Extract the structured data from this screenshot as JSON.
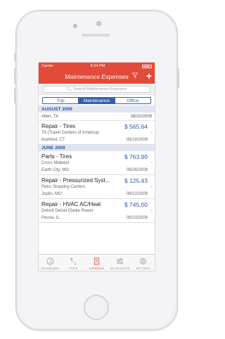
{
  "status": {
    "carrier": "Carrier",
    "time": "9:24 PM"
  },
  "nav": {
    "title": "Maintenance Expenses",
    "filter_icon": "filter-icon",
    "add_icon": "plus-icon"
  },
  "search": {
    "placeholder": "Search Maintenance Expenses"
  },
  "segments": [
    {
      "label": "Trip",
      "active": false
    },
    {
      "label": "Maintenance",
      "active": true
    },
    {
      "label": "Office",
      "active": false
    }
  ],
  "sections": [
    {
      "header": "AUGUST 2009",
      "summary": {
        "location": "Allen, TX",
        "date": "08/20/2009"
      },
      "rows": [
        {
          "title": "Repair - Tires",
          "amount": "$ 565.64",
          "vendor": "TA (Travel Centers of America)",
          "location": "branford, CT",
          "date": "08/18/2009"
        }
      ]
    },
    {
      "header": "JUNE 2009",
      "rows": [
        {
          "title": "Parts - Tires",
          "amount": "$ 763.90",
          "vendor": "Cross Midwest",
          "location": "Earth City, MO",
          "date": "06/26/2009"
        },
        {
          "title": "Repair - Pressurized Syst...",
          "amount": "$ 125.43",
          "vendor": "Petro Stopping Centers",
          "location": "Joplin, MO",
          "date": "06/12/2009"
        },
        {
          "title": "Repair - HVAC AC/Heat",
          "amount": "$ 745.00",
          "vendor": "Detroit Deisel Clarke Power",
          "location": "Peoria, IL",
          "date": "06/10/2009"
        }
      ]
    }
  ],
  "tabs": [
    {
      "label": "DASHBOARD",
      "icon": "dashboard-gauge-icon",
      "active": false
    },
    {
      "label": "TRIPS",
      "icon": "route-pin-icon",
      "active": false
    },
    {
      "label": "EXPENSES",
      "icon": "receipt-icon",
      "active": true
    },
    {
      "label": "MY BUSINESS",
      "icon": "sliders-icon",
      "active": false
    },
    {
      "label": "SETTINGS",
      "icon": "gear-icon",
      "active": false
    }
  ],
  "colors": {
    "accent": "#e24b3a",
    "link": "#3560b0",
    "section_bg": "#dfe6f2"
  }
}
